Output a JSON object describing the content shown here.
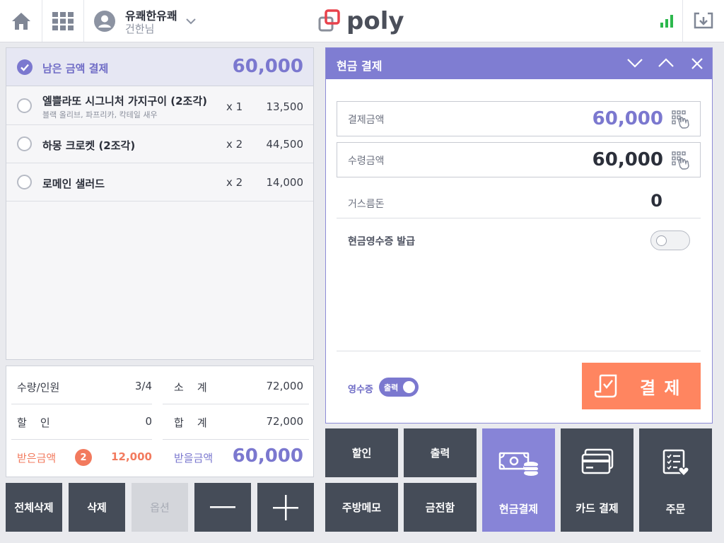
{
  "topbar": {
    "store_name": "유쾌한유쾌",
    "user_name": "건한님",
    "logo_text": "poly"
  },
  "order": {
    "remain_label": "남은 금액 결제",
    "remain_amount": "60,000",
    "items": [
      {
        "name": "엘쁠라또 시그니처 가지구이 (2조각)",
        "option": "블랙 올리브, 파프리카, 칵테일 새우",
        "qty": "x 1",
        "price": "13,500"
      },
      {
        "name": "하몽 크로켓 (2조각)",
        "option": "",
        "qty": "x 2",
        "price": "44,500"
      },
      {
        "name": "로메인 샐러드",
        "option": "",
        "qty": "x 2",
        "price": "14,000"
      }
    ]
  },
  "summary": {
    "qty_label": "수량/인원",
    "qty_value": "3/4",
    "subtotal_label": "소    계",
    "subtotal_value": "72,000",
    "discount_label": "할    인",
    "discount_value": "0",
    "total_label": "합    계",
    "total_value": "72,000",
    "received_label": "받은금액",
    "received_count": "2",
    "received_value": "12,000",
    "due_label": "받을금액",
    "due_value": "60,000"
  },
  "actions": {
    "delete_all": "전체삭제",
    "delete": "삭제",
    "option": "옵션"
  },
  "cash": {
    "title": "현금 결제",
    "pay_amount_label": "결제금액",
    "pay_amount_value": "60,000",
    "received_label": "수령금액",
    "received_value": "60,000",
    "change_label": "거스름돈",
    "change_value": "0",
    "receipt_issue_label": "현금영수증 발급",
    "receipt_label": "영수증",
    "receipt_toggle_text": "출력",
    "pay_button": "결 제"
  },
  "functions": {
    "discount": "할인",
    "print": "출력",
    "cash_pay": "현금결제",
    "card_pay": "카드 결제",
    "order": "주문",
    "kitchen_memo": "주방메모",
    "cash_drawer": "금전함"
  },
  "colors": {
    "accent": "#7f7dd2",
    "accent_text": "#7b78cf",
    "pay_button": "#ff8560",
    "received_red": "#f27a5e",
    "dark_button": "#454c58",
    "signal_green": "#2db84d",
    "logo_red": "#e8424c"
  }
}
